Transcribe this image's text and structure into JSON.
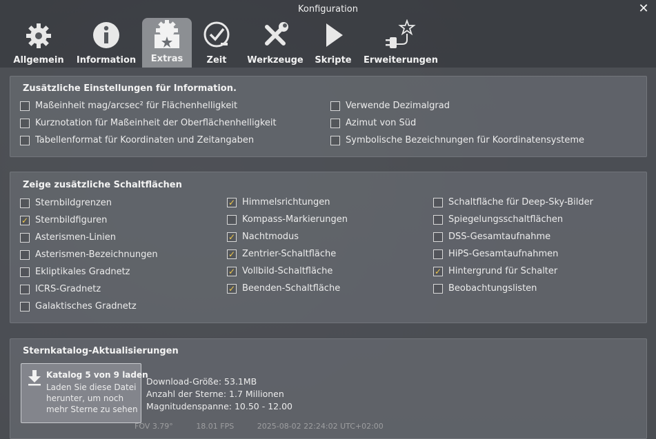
{
  "window": {
    "title": "Konfiguration",
    "close_label": "✕"
  },
  "tabs": [
    {
      "label": "Allgemein",
      "icon": "gear-icon"
    },
    {
      "label": "Information",
      "icon": "info-icon"
    },
    {
      "label": "Extras",
      "icon": "extras-gear-icon",
      "active": true
    },
    {
      "label": "Zeit",
      "icon": "clock-icon"
    },
    {
      "label": "Werkzeuge",
      "icon": "tools-icon"
    },
    {
      "label": "Skripte",
      "icon": "play-icon"
    },
    {
      "label": "Erweiterungen",
      "icon": "plugin-star-icon"
    }
  ],
  "info_group": {
    "title": "Zusätzliche Einstellungen für Information.",
    "left": [
      {
        "label": "Maßeinheit mag/arcsec² für Flächenhelligkeit",
        "checked": false
      },
      {
        "label": "Kurznotation für Maßeinheit der Oberflächenhelligkeit",
        "checked": false
      },
      {
        "label": "Tabellenformat für Koordinaten und Zeitangaben",
        "checked": false
      }
    ],
    "right": [
      {
        "label": "Verwende Dezimalgrad",
        "checked": false
      },
      {
        "label": "Azimut von Süd",
        "checked": false
      },
      {
        "label": "Symbolische Bezeichnungen für Koordinatensysteme",
        "checked": false
      }
    ]
  },
  "buttons_group": {
    "title": "Zeige zusätzliche Schaltflächen",
    "col1": [
      {
        "label": "Sternbildgrenzen",
        "checked": false
      },
      {
        "label": "Sternbildfiguren",
        "checked": true
      },
      {
        "label": "Asterismen-Linien",
        "checked": false
      },
      {
        "label": "Asterismen-Bezeichnungen",
        "checked": false
      },
      {
        "label": "Ekliptikales Gradnetz",
        "checked": false
      },
      {
        "label": "ICRS-Gradnetz",
        "checked": false
      },
      {
        "label": "Galaktisches Gradnetz",
        "checked": false
      }
    ],
    "col2": [
      {
        "label": "Himmelsrichtungen",
        "checked": true
      },
      {
        "label": "Kompass-Markierungen",
        "checked": false
      },
      {
        "label": "Nachtmodus",
        "checked": true
      },
      {
        "label": "Zentrier-Schaltfläche",
        "checked": true
      },
      {
        "label": "Vollbild-Schaltfläche",
        "checked": true
      },
      {
        "label": "Beenden-Schaltfläche",
        "checked": true
      }
    ],
    "col3": [
      {
        "label": "Schaltfläche für Deep-Sky-Bilder",
        "checked": false
      },
      {
        "label": "Spiegelungsschaltflächen",
        "checked": false
      },
      {
        "label": "DSS-Gesamtaufnahme",
        "checked": false
      },
      {
        "label": "HiPS-Gesamtaufnahmen",
        "checked": false
      },
      {
        "label": "Hintergrund für Schalter",
        "checked": true
      },
      {
        "label": "Beobachtungslisten",
        "checked": false
      }
    ]
  },
  "catalog_group": {
    "title": "Sternkatalog-Aktualisierungen",
    "button_title": "Katalog 5 von 9 laden",
    "button_desc": "Laden Sie diese Datei herunter, um noch mehr Sterne zu sehen",
    "download_size": "Download-Größe: 53.1MB",
    "star_count": "Anzahl der Sterne: 1.7 Millionen",
    "magnitude_range": "Magnitudenspanne: 10.50 - 12.00"
  },
  "statusbar": {
    "fov": "FOV 3.79°",
    "fps": "18.01 FPS",
    "datetime": "2025-08-02 22:24:02 UTC+02:00"
  },
  "colors": {
    "check": "#f0c84a",
    "accent_tab": "#cdd0d4"
  }
}
